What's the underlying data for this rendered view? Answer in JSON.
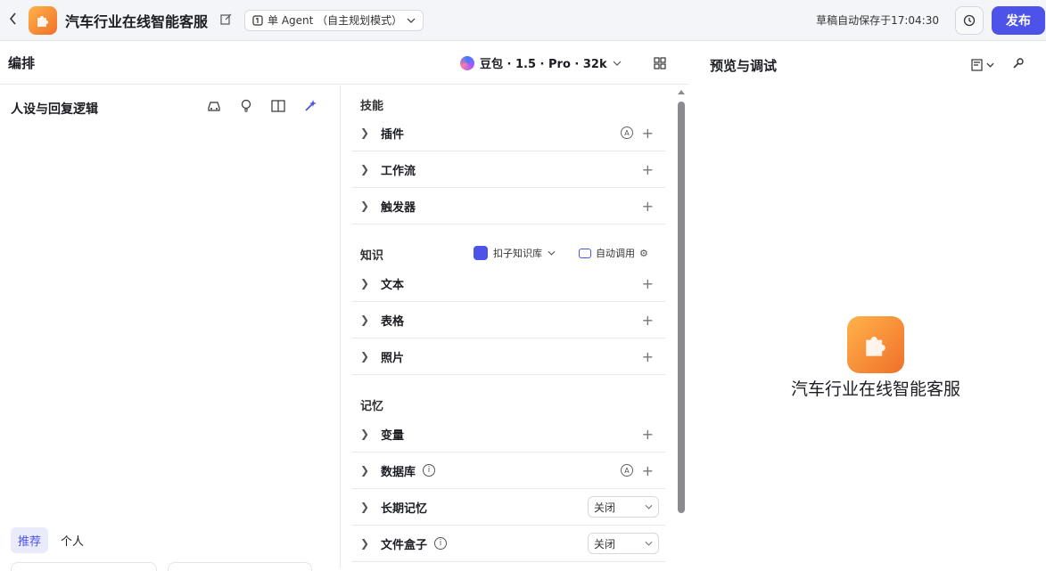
{
  "topbar": {
    "back_icon": "chevron-left-icon",
    "app_title": "汽车行业在线智能客服",
    "mode_label": "单 Agent （自主规划模式）",
    "save_status": "草稿自动保存于17:04:30",
    "publish_label": "发布"
  },
  "edit_panel": {
    "title": "编排",
    "model_label": "豆包 · 1.5 · Pro · 32k"
  },
  "persona": {
    "title": "人设与回复逻辑",
    "tabs": [
      "推荐",
      "个人"
    ]
  },
  "skills": {
    "title": "技能",
    "rows": [
      "插件",
      "工作流",
      "触发器"
    ]
  },
  "knowledge": {
    "title": "知识",
    "source_label": "扣子知识库",
    "auto_call_label": "自动调用",
    "rows": [
      "文本",
      "表格",
      "照片"
    ]
  },
  "memory": {
    "title": "记忆",
    "rows": [
      "变量",
      "数据库",
      "长期记忆",
      "文件盒子"
    ],
    "long_term_value": "关闭",
    "file_box_value": "关闭"
  },
  "preview": {
    "title": "预览与调试",
    "bot_name": "汽车行业在线智能客服"
  },
  "colors": {
    "accent": "#4d53e8",
    "app_icon_start": "#ffb24a",
    "app_icon_end": "#f0702a",
    "topbar_bg": "#f4f5f9"
  }
}
